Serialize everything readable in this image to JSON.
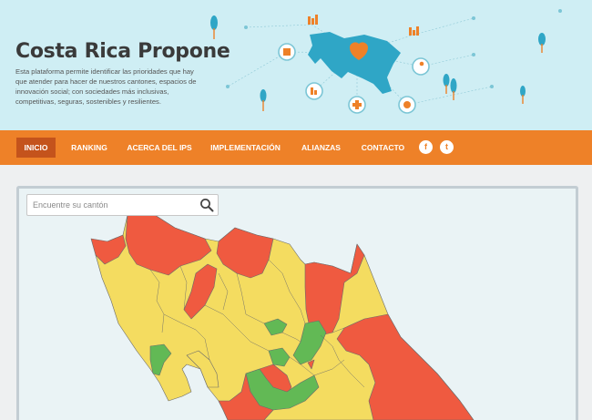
{
  "hero": {
    "title": "Costa Rica Propone",
    "description": "Esta plataforma permite identificar las prioridades que hay que atender para hacer de nuestros cantones, espacios de innovación social; con sociedades más inclusivas, competitivas, seguras, sostenibles y resilientes."
  },
  "nav": {
    "items": [
      {
        "label": "INICIO",
        "active": true
      },
      {
        "label": "RANKING",
        "active": false
      },
      {
        "label": "ACERCA DEL IPS",
        "active": false
      },
      {
        "label": "IMPLEMENTACIÓN",
        "active": false
      },
      {
        "label": "ALIANZAS",
        "active": false
      },
      {
        "label": "CONTACTO",
        "active": false
      }
    ],
    "social": [
      {
        "icon": "facebook-icon",
        "glyph": "f"
      },
      {
        "icon": "twitter-icon",
        "glyph": "t"
      }
    ]
  },
  "map": {
    "search_placeholder": "Encuentre su cantón"
  },
  "colors": {
    "hero_bg": "#cfeef4",
    "nav_bg": "#ee8128",
    "nav_active": "#c4531c",
    "map_red": "#ef5a40",
    "map_yellow": "#f4dc60",
    "map_green": "#62b955",
    "map_border": "#6b6b6b"
  }
}
